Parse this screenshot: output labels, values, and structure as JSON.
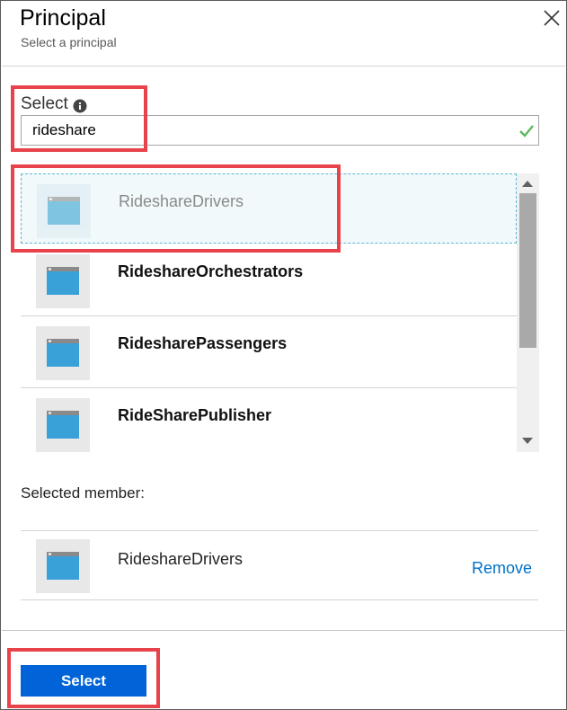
{
  "panel": {
    "title": "Principal",
    "subtitle": "Select a principal"
  },
  "search": {
    "label": "Select",
    "value": "rideshare"
  },
  "results": [
    {
      "label": "RideshareDrivers",
      "selected": true
    },
    {
      "label": "RideshareOrchestrators",
      "selected": false
    },
    {
      "label": "RidesharePassengers",
      "selected": false
    },
    {
      "label": "RideSharePublisher",
      "selected": false
    }
  ],
  "selected_members": {
    "heading": "Selected member:",
    "items": [
      {
        "label": "RideshareDrivers",
        "remove_label": "Remove"
      }
    ]
  },
  "footer": {
    "select_button_label": "Select"
  },
  "icons": {
    "close": "close-icon",
    "info": "info-icon",
    "valid": "check-icon",
    "app": "app-window-icon"
  },
  "colors": {
    "accent": "#0064d8",
    "link": "#0072c6",
    "valid": "#5cb85c",
    "highlight": "#e8434a",
    "selected_row": "#f1f9fb"
  }
}
